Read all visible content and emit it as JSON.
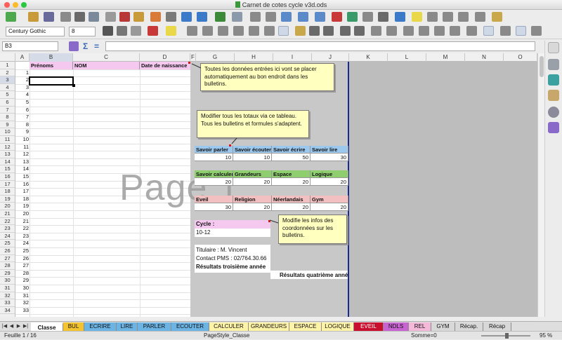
{
  "window": {
    "title": "Carnet de cotes cycle v3d.ods"
  },
  "format": {
    "font_name": "Century Gothic",
    "font_size": "8"
  },
  "formula": {
    "cell_ref": "B3",
    "content": ""
  },
  "columns": [
    "A",
    "B",
    "C",
    "D",
    "F",
    "G",
    "H",
    "I",
    "J",
    "K",
    "L",
    "M",
    "N",
    "O"
  ],
  "rows": [
    "1",
    "2",
    "3",
    "4",
    "5",
    "6",
    "7",
    "8",
    "9",
    "10",
    "11",
    "12",
    "13",
    "14",
    "15",
    "16",
    "17",
    "18",
    "19",
    "20",
    "21",
    "22",
    "23",
    "24",
    "25",
    "26",
    "27",
    "28",
    "29",
    "30",
    "31",
    "32",
    "33",
    "34"
  ],
  "col_a_numbers": [
    "1",
    "2",
    "3",
    "4",
    "5",
    "6",
    "7",
    "8",
    "9",
    "10",
    "11",
    "12",
    "13",
    "14",
    "15",
    "16",
    "17",
    "18",
    "19",
    "20",
    "21",
    "22",
    "23",
    "24",
    "25",
    "26",
    "27",
    "28",
    "29",
    "30",
    "31",
    "32",
    "33"
  ],
  "headers": {
    "prenoms": "Prénoms",
    "nom": "NOM",
    "date": "Date de naissance"
  },
  "watermark": "Page 1",
  "notes": {
    "note1": "Toutes les données entrées ici vont se placer automatiquement au bon endroit dans les bulletins.",
    "note2": "Modifier tous les totaux via ce tableau. Tous les bulletins et formules s'adaptent.",
    "note3": "Modifie les infos des coordonnées sur les bulletins."
  },
  "table1": {
    "headers": [
      "Savoir parler",
      "Savoir écouter",
      "Savoir écrire",
      "Savoir lire"
    ],
    "values": [
      "10",
      "10",
      "50",
      "30"
    ]
  },
  "table2": {
    "headers": [
      "Savoir calculer",
      "Grandeurs",
      "Espace",
      "Logique"
    ],
    "values": [
      "20",
      "20",
      "20",
      "20"
    ]
  },
  "table3": {
    "headers": [
      "Eveil",
      "Religion",
      "Néerlandais",
      "Gym"
    ],
    "values": [
      "30",
      "20",
      "20",
      "20"
    ]
  },
  "cycle": {
    "label": "Cycle :",
    "value": "10-12"
  },
  "info": {
    "titulaire": "Titulaire : M. Vincent",
    "contact": "Contact PMS : 02/764.30.66",
    "res3": "Résultats troisième année",
    "res4": "Résultats quatrième année"
  },
  "tabs": [
    {
      "label": "Classe",
      "color": "#ffffff"
    },
    {
      "label": "BUL",
      "color": "#f4c430"
    },
    {
      "label": "ECRIRE",
      "color": "#6cb4e4"
    },
    {
      "label": "LIRE",
      "color": "#6cb4e4"
    },
    {
      "label": "PARLER",
      "color": "#6cb4e4"
    },
    {
      "label": "ECOUTER",
      "color": "#6cb4e4"
    },
    {
      "label": "CALCULER",
      "color": "#fff3a8"
    },
    {
      "label": "GRANDEURS",
      "color": "#fff3a8"
    },
    {
      "label": "ESPACE",
      "color": "#fff3a8"
    },
    {
      "label": "LOGIQUE",
      "color": "#fff3a8"
    },
    {
      "label": "EVEIL",
      "color": "#c8102e"
    },
    {
      "label": "NDLS",
      "color": "#c864d2"
    },
    {
      "label": "REL",
      "color": "#f4b8d8"
    },
    {
      "label": "GYM",
      "color": "#d8d8d8"
    },
    {
      "label": "Récap.",
      "color": "#d8d8d8"
    },
    {
      "label": "Récap",
      "color": "#d8d8d8"
    }
  ],
  "status": {
    "sheet": "Feuille 1 / 16",
    "style": "PageStyle_Classe",
    "sum": "Somme=0",
    "zoom": "95 %"
  }
}
